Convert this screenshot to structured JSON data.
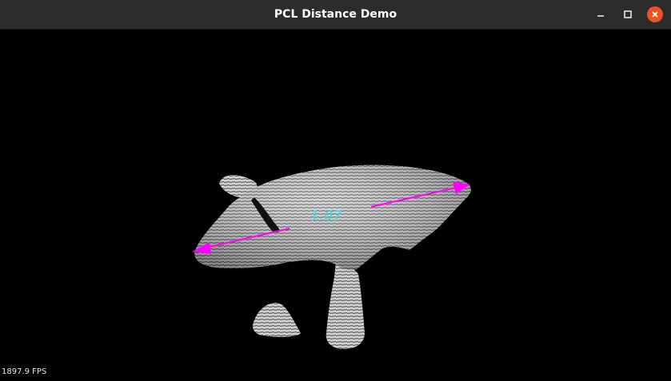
{
  "window": {
    "title": "PCL Distance Demo",
    "controls": {
      "minimize_icon": "minimize-icon",
      "maximize_icon": "maximize-icon",
      "close_icon": "close-icon",
      "close_color": "#e95420"
    }
  },
  "viewer": {
    "background_color": "#000000",
    "distance_label": "1.07",
    "distance_label_color": "#29e0e6",
    "arrow_color": "#ff00ff",
    "point_cloud_color": "#c8c8c8",
    "fps_text": "1897.9 FPS"
  }
}
